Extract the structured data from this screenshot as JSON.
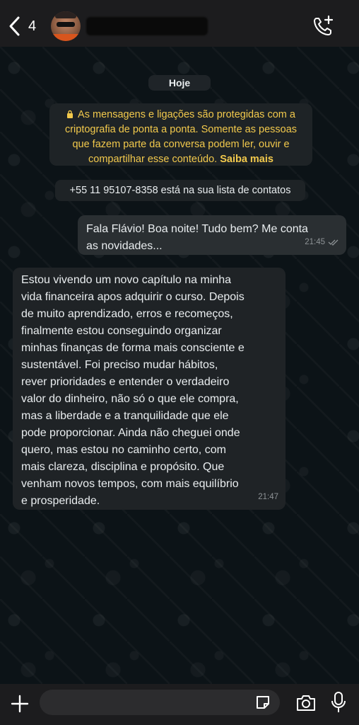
{
  "header": {
    "back_count": "4",
    "contact_name": "",
    "icons": {
      "back": "chevron-left-icon",
      "call": "add-call-icon",
      "avatar": "avatar"
    }
  },
  "chat": {
    "date_label": "Hoje",
    "encryption_notice": {
      "line1": "As mensagens e ligações são protegidas com a",
      "line2": "criptografia de ponta a ponta. Somente as pessoas",
      "line3": "que fazem parte da conversa podem ler, ouvir e",
      "line4": "compartilhar esse conteúdo.",
      "learn_more": "Saiba mais",
      "icon": "lock-icon"
    },
    "contact_notice": "+55 11 95107-8358 está na sua lista de contatos",
    "messages": [
      {
        "direction": "outgoing",
        "lines": [
          "Fala Flávio! Boa noite! Tudo bem? Me conta",
          "as novidades..."
        ],
        "time": "21:45",
        "status": "read"
      },
      {
        "direction": "incoming",
        "lines": [
          "Estou vivendo um novo capítulo na minha",
          "vida financeira apos adquirir o curso. Depois",
          "de muito aprendizado, erros e recomeços,",
          "finalmente estou conseguindo organizar",
          "minhas finanças de forma mais consciente e",
          "sustentável. Foi preciso mudar hábitos,",
          "rever prioridades e entender o verdadeiro",
          "valor do dinheiro, não só o que ele compra,",
          "mas a liberdade e a tranquilidade que ele",
          "pode proporcionar. Ainda não cheguei onde",
          "quero, mas estou no caminho certo, com",
          "mais clareza, disciplina e propósito. Que",
          "venham novos tempos, com mais equilíbrio",
          "e prosperidade."
        ],
        "time": "21:47"
      }
    ]
  },
  "input_bar": {
    "placeholder": "",
    "icons": [
      "plus-icon",
      "sticker-icon",
      "camera-icon",
      "microphone-icon"
    ]
  },
  "colors": {
    "header_bg": "#1c1c1e",
    "chat_bg": "#0c1317",
    "encryption_text": "#f2c94c",
    "outgoing_bubble": "#2a2f32",
    "incoming_bubble": "#1f2326"
  }
}
